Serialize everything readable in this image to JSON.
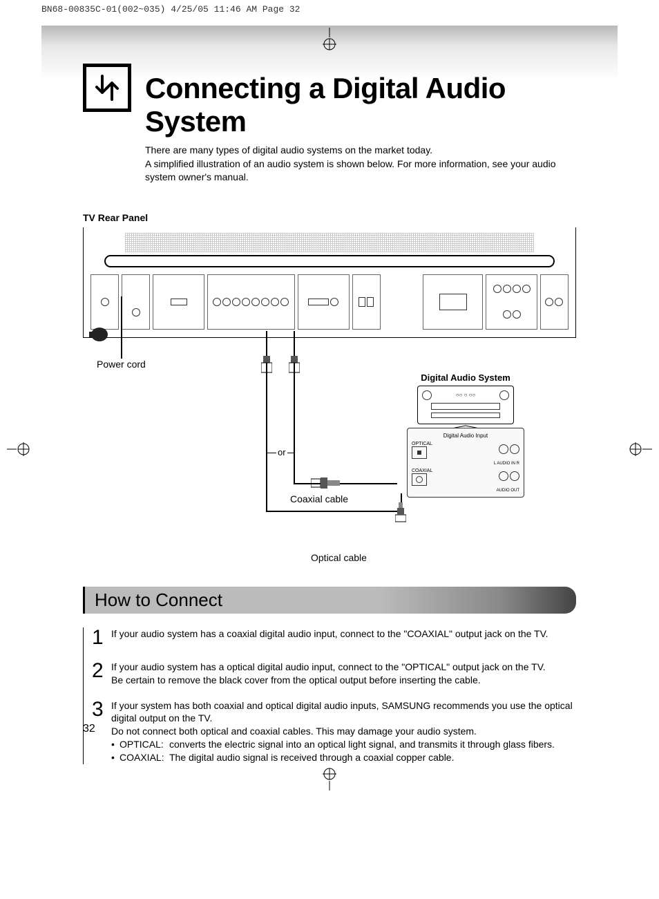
{
  "header": "BN68-00835C-01(002~035)  4/25/05  11:46 AM  Page 32",
  "title": "Connecting a Digital Audio System",
  "intro": "There are many types of digital audio systems on the market today.\nA simplified illustration of an audio system is shown below. For more information, see your audio system owner's manual.",
  "diagram": {
    "panel_label": "TV Rear Panel",
    "power_cord": "Power cord",
    "audio_system": "Digital Audio System",
    "or": "or",
    "coaxial": "Coaxial cable",
    "optical": "Optical cable",
    "digi_panel_title": "Digital Audio Input",
    "digi_optical": "OPTICAL",
    "digi_coaxial": "COAXIAL",
    "digi_audio_in": "L  AUDIO IN  R",
    "digi_audio_out": "AUDIO OUT"
  },
  "how_to": {
    "title": "How to Connect",
    "steps": [
      {
        "n": "1",
        "text": "If your audio system has a coaxial digital audio input, connect to the \"COAXIAL\" output jack on the TV."
      },
      {
        "n": "2",
        "text": "If your audio system has a optical digital audio input, connect to the \"OPTICAL\" output jack on the TV.\nBe certain to remove the black cover from the optical output before inserting the cable."
      },
      {
        "n": "3",
        "text": "If your system has both coaxial and optical digital audio inputs, SAMSUNG recommends you use the optical digital output on the TV.\nDo not connect both optical and coaxial cables. This may damage your audio system.",
        "bullets": [
          {
            "label": "OPTICAL:",
            "desc": "converts the electric signal into an optical light signal, and transmits it through glass fibers."
          },
          {
            "label": "COAXIAL:",
            "desc": "The digital audio signal is received through a coaxial copper cable."
          }
        ]
      }
    ]
  },
  "page": "32"
}
